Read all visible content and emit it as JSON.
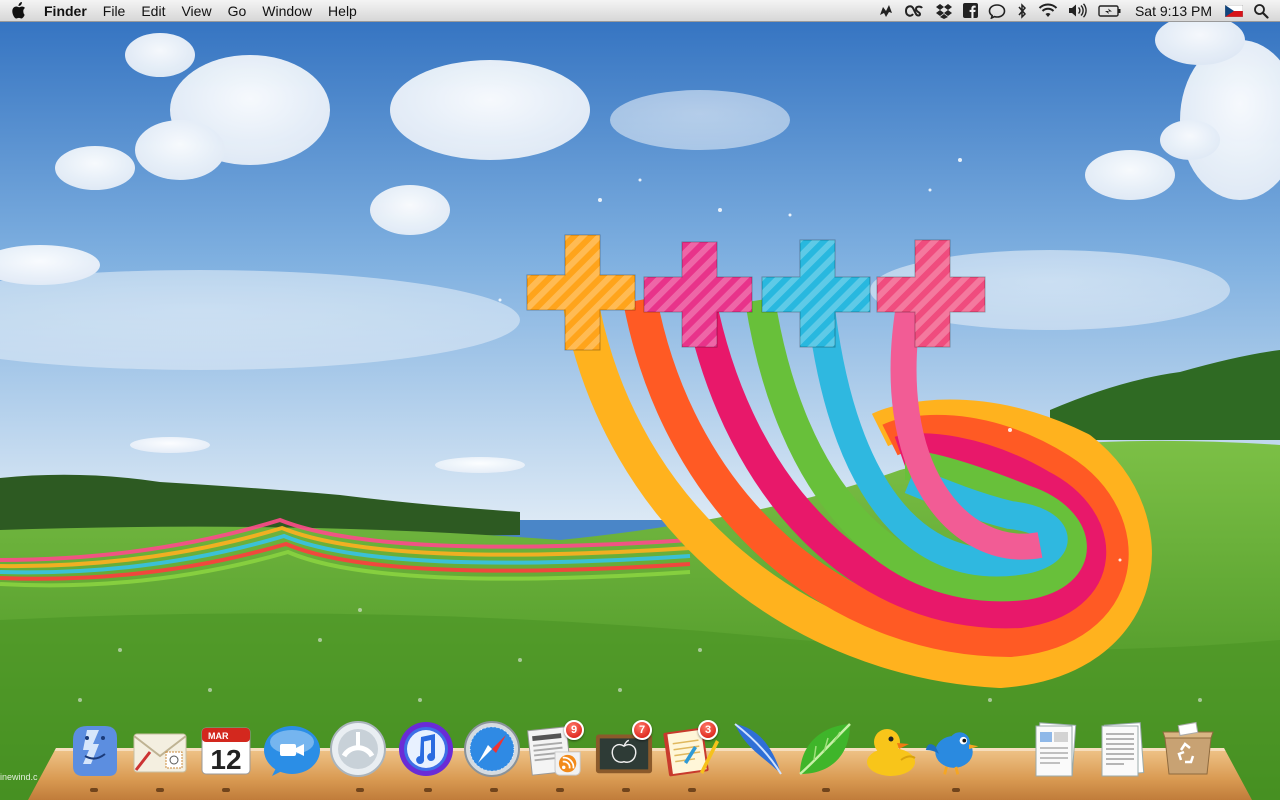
{
  "menubar": {
    "apple_icon": "apple-icon",
    "items": [
      "Finder",
      "File",
      "Edit",
      "View",
      "Go",
      "Window",
      "Help"
    ],
    "status_icons": [
      "skype-icon",
      "lastfm-icon",
      "dropbox-icon",
      "facebook-icon",
      "speech-bubble-icon",
      "bluetooth-icon",
      "wifi-icon",
      "volume-icon",
      "battery-icon"
    ],
    "clock": "Sat 9:13 PM",
    "input_flag": "czech-flag-icon",
    "spotlight": "spotlight-icon"
  },
  "wallpaper": {
    "description_icons": [
      "plus-orange",
      "plus-magenta",
      "plus-cyan",
      "plus-pink"
    ],
    "watermark": "inewind.c"
  },
  "dock": {
    "apps": [
      {
        "id": "finder",
        "icon": "finder-icon"
      },
      {
        "id": "mail",
        "icon": "mail-stamp-icon"
      },
      {
        "id": "calendar",
        "icon": "calendar-icon",
        "month": "MAR",
        "day": "12"
      },
      {
        "id": "facetime",
        "icon": "video-chat-icon"
      },
      {
        "id": "grooveshark",
        "icon": "grooveshark-icon"
      },
      {
        "id": "itunes",
        "icon": "music-note-icon"
      },
      {
        "id": "safari",
        "icon": "compass-icon"
      },
      {
        "id": "news",
        "icon": "newspaper-rss-icon",
        "badge": "9"
      },
      {
        "id": "apple-school",
        "icon": "chalkboard-apple-icon",
        "badge": "7"
      },
      {
        "id": "notes",
        "icon": "notebook-icon",
        "badge": "3"
      },
      {
        "id": "quill",
        "icon": "feather-icon"
      },
      {
        "id": "leaf",
        "icon": "leaf-icon"
      },
      {
        "id": "cyberduck",
        "icon": "duck-icon"
      },
      {
        "id": "twitter",
        "icon": "bird-icon"
      },
      {
        "id": "doc-stack-1",
        "icon": "document-stack-icon"
      },
      {
        "id": "doc-stack-2",
        "icon": "document-stack-icon"
      },
      {
        "id": "trash",
        "icon": "recycle-box-icon"
      }
    ]
  },
  "colors": {
    "menubar_top": "#f4f4f4",
    "menubar_bottom": "#d7d7d7",
    "sky": "#3f7fc8",
    "grass": "#5aa02c",
    "dock_wood": "#d99a52",
    "badge": "#d40f06"
  }
}
